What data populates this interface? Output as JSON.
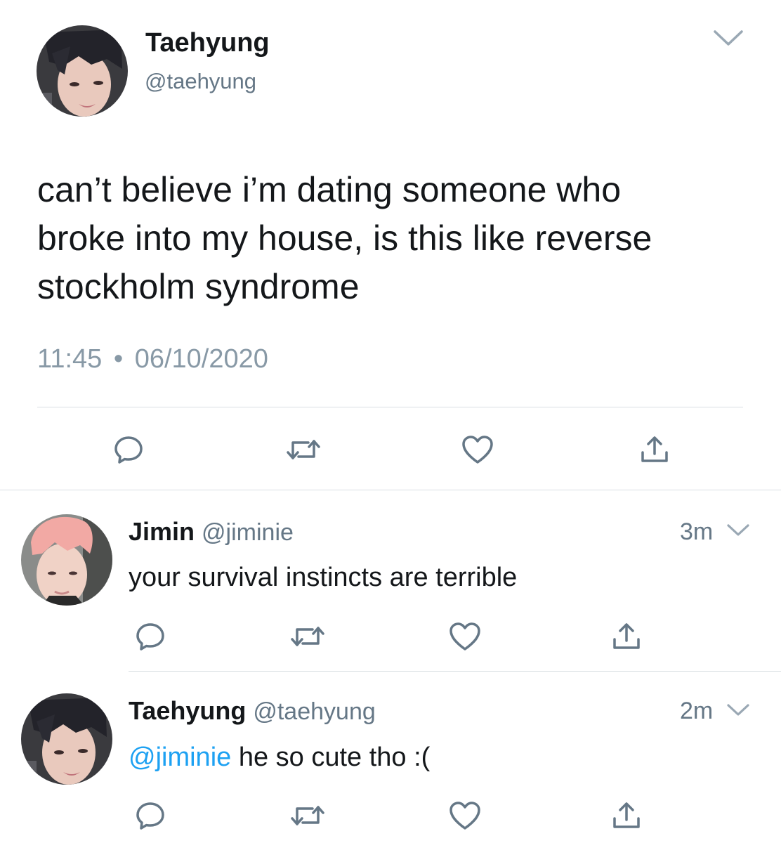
{
  "main_tweet": {
    "display_name": "Taehyung",
    "handle": "@taehyung",
    "text_lines": [
      "can’t believe i’m dating someone who",
      "broke into my house, is this like reverse",
      "stockholm syndrome"
    ],
    "time": "11:45",
    "separator": "•",
    "date": "06/10/2020"
  },
  "replies": [
    {
      "display_name": "Jimin",
      "handle": "@jiminie",
      "time_ago": "3m",
      "text": "your survival instincts are terrible",
      "mention": "",
      "text_after_mention": ""
    },
    {
      "display_name": "Taehyung",
      "handle": "@taehyung",
      "time_ago": "2m",
      "mention": "@jiminie",
      "text_after_mention": " he so cute tho :("
    }
  ],
  "icons": {
    "reply": "reply-icon",
    "retweet": "retweet-icon",
    "like": "heart-icon",
    "share": "share-icon",
    "more": "chevron-down-icon"
  },
  "colors": {
    "text": "#14171a",
    "secondary": "#657786",
    "meta": "#8899a6",
    "link": "#1da1f2",
    "icon": "#657786",
    "divider": "#d9dfe3"
  }
}
